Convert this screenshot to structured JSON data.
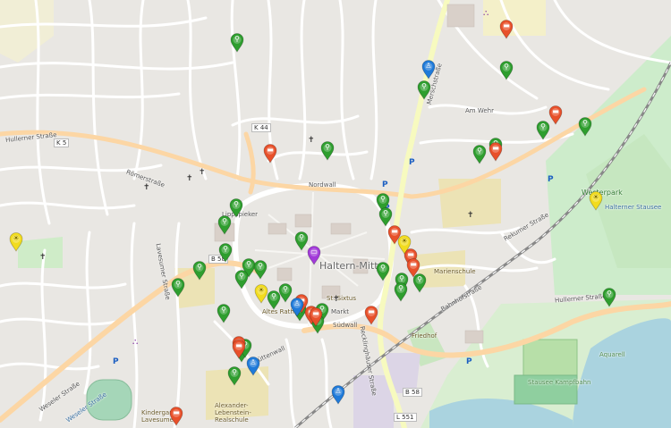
{
  "map": {
    "town_label": "Haltern-Mitte",
    "road_labels": [
      {
        "id": "k5",
        "text": "K 5"
      },
      {
        "id": "k44",
        "text": "K 44"
      },
      {
        "id": "b58-west",
        "text": "B 58"
      },
      {
        "id": "b58-east",
        "text": "B 58"
      },
      {
        "id": "l551",
        "text": "L 551"
      }
    ],
    "street_labels": [
      {
        "id": "st1",
        "text": "Hullerner Straße"
      },
      {
        "id": "st2",
        "text": "Römerstraße"
      },
      {
        "id": "st3",
        "text": "Lippspieker"
      },
      {
        "id": "st4",
        "text": "Nordwall"
      },
      {
        "id": "st5",
        "text": "Merschstraße"
      },
      {
        "id": "st6",
        "text": "Bahnhofstraße"
      },
      {
        "id": "st7",
        "text": "Hullerner Straße"
      },
      {
        "id": "st8",
        "text": "Weseler Straße"
      },
      {
        "id": "st9",
        "text": "Schüttenwall"
      },
      {
        "id": "st10",
        "text": "Recklinghäuser Straße"
      },
      {
        "id": "st11",
        "text": "Markt"
      },
      {
        "id": "st12",
        "text": "Südwall"
      },
      {
        "id": "st13",
        "text": "Rekumer Straße"
      },
      {
        "id": "st14",
        "text": "Am Wehr"
      },
      {
        "id": "st15",
        "text": "Lavesumer Straße"
      }
    ],
    "place_labels": [
      {
        "id": "pl1",
        "text": "Weseler Straße",
        "class": "water"
      },
      {
        "id": "pl2",
        "text": "Westerpark",
        "class": "park"
      },
      {
        "id": "pl3",
        "text": "Halterner Stausee",
        "class": "water"
      },
      {
        "id": "pl4",
        "text": "Stausee Kampfbahn",
        "class": "sport"
      },
      {
        "id": "pl5",
        "text": "Aquarell",
        "class": "sport"
      },
      {
        "id": "pl6",
        "text": "Alexander-Lebenstein-Realschule",
        "class": "school"
      },
      {
        "id": "pl7",
        "text": "Kindergarten Lavesumer",
        "class": "school"
      },
      {
        "id": "pl8",
        "text": "St. Sixtus",
        "class": "school"
      },
      {
        "id": "pl9",
        "text": "Altes Rathaus",
        "class": "school"
      },
      {
        "id": "pl10",
        "text": "Marienschule",
        "class": "school"
      },
      {
        "id": "pl11",
        "text": "Friedhof",
        "class": "school"
      }
    ],
    "markers": [
      {
        "id": "m1",
        "kind": "bike",
        "color": "#2e9e2e",
        "icon": "bicycle-icon"
      },
      {
        "id": "m2",
        "kind": "bike",
        "color": "#2e9e2e",
        "icon": "bicycle-icon"
      },
      {
        "id": "m3",
        "kind": "bike",
        "color": "#2e9e2e",
        "icon": "bicycle-icon"
      },
      {
        "id": "m4",
        "kind": "bike",
        "color": "#2e9e2e",
        "icon": "bicycle-icon"
      },
      {
        "id": "m5",
        "kind": "bike",
        "color": "#2e9e2e",
        "icon": "bicycle-icon"
      },
      {
        "id": "m6",
        "kind": "bike",
        "color": "#2e9e2e",
        "icon": "bicycle-icon"
      },
      {
        "id": "m7",
        "kind": "bike",
        "color": "#2e9e2e",
        "icon": "bicycle-icon"
      },
      {
        "id": "m8",
        "kind": "bike",
        "color": "#2e9e2e",
        "icon": "bicycle-icon"
      },
      {
        "id": "m9",
        "kind": "bike",
        "color": "#2e9e2e",
        "icon": "bicycle-icon"
      },
      {
        "id": "m10",
        "kind": "bike",
        "color": "#2e9e2e",
        "icon": "bicycle-icon"
      },
      {
        "id": "m11",
        "kind": "bike",
        "color": "#2e9e2e",
        "icon": "bicycle-icon"
      },
      {
        "id": "m12",
        "kind": "bike",
        "color": "#2e9e2e",
        "icon": "bicycle-icon"
      },
      {
        "id": "m13",
        "kind": "bike",
        "color": "#2e9e2e",
        "icon": "bicycle-icon"
      },
      {
        "id": "m14",
        "kind": "bike",
        "color": "#2e9e2e",
        "icon": "bicycle-icon"
      },
      {
        "id": "m15",
        "kind": "bike",
        "color": "#2e9e2e",
        "icon": "bicycle-icon"
      },
      {
        "id": "m16",
        "kind": "bike",
        "color": "#2e9e2e",
        "icon": "bicycle-icon"
      },
      {
        "id": "m17",
        "kind": "bike",
        "color": "#2e9e2e",
        "icon": "bicycle-icon"
      },
      {
        "id": "m18",
        "kind": "bike",
        "color": "#2e9e2e",
        "icon": "bicycle-icon"
      },
      {
        "id": "m19",
        "kind": "bike",
        "color": "#2e9e2e",
        "icon": "bicycle-icon"
      },
      {
        "id": "m20",
        "kind": "bike",
        "color": "#2e9e2e",
        "icon": "bicycle-icon"
      },
      {
        "id": "m21",
        "kind": "bike",
        "color": "#2e9e2e",
        "icon": "bicycle-icon"
      },
      {
        "id": "m22",
        "kind": "bike",
        "color": "#2e9e2e",
        "icon": "bicycle-icon"
      },
      {
        "id": "m23",
        "kind": "bike",
        "color": "#2e9e2e",
        "icon": "bicycle-icon"
      },
      {
        "id": "m24",
        "kind": "bike",
        "color": "#2e9e2e",
        "icon": "bicycle-icon"
      },
      {
        "id": "m25",
        "kind": "bike",
        "color": "#2e9e2e",
        "icon": "bicycle-icon"
      },
      {
        "id": "m26",
        "kind": "bike",
        "color": "#2e9e2e",
        "icon": "bicycle-icon"
      },
      {
        "id": "m27",
        "kind": "bike",
        "color": "#2e9e2e",
        "icon": "bicycle-icon"
      },
      {
        "id": "m28",
        "kind": "bike",
        "color": "#2e9e2e",
        "icon": "bicycle-icon"
      },
      {
        "id": "m29",
        "kind": "bike",
        "color": "#2e9e2e",
        "icon": "bicycle-icon"
      },
      {
        "id": "m30",
        "kind": "bike",
        "color": "#2e9e2e",
        "icon": "bicycle-icon"
      },
      {
        "id": "m31",
        "kind": "bike",
        "color": "#2e9e2e",
        "icon": "bicycle-icon"
      },
      {
        "id": "m32",
        "kind": "bike",
        "color": "#2e9e2e",
        "icon": "bicycle-icon"
      },
      {
        "id": "m33",
        "kind": "bike",
        "color": "#2e9e2e",
        "icon": "bicycle-icon"
      },
      {
        "id": "m34",
        "kind": "car",
        "color": "#e8502a",
        "icon": "car-icon"
      },
      {
        "id": "m35",
        "kind": "car",
        "color": "#e8502a",
        "icon": "car-icon"
      },
      {
        "id": "m36",
        "kind": "car",
        "color": "#e8502a",
        "icon": "car-icon"
      },
      {
        "id": "m37",
        "kind": "car",
        "color": "#e8502a",
        "icon": "car-icon"
      },
      {
        "id": "m38",
        "kind": "car",
        "color": "#e8502a",
        "icon": "car-icon"
      },
      {
        "id": "m39",
        "kind": "car",
        "color": "#e8502a",
        "icon": "car-icon"
      },
      {
        "id": "m40",
        "kind": "car",
        "color": "#e8502a",
        "icon": "car-icon"
      },
      {
        "id": "m41",
        "kind": "car",
        "color": "#e8502a",
        "icon": "car-icon"
      },
      {
        "id": "m42",
        "kind": "car",
        "color": "#e8502a",
        "icon": "car-icon"
      },
      {
        "id": "m43",
        "kind": "car",
        "color": "#e8502a",
        "icon": "car-icon"
      },
      {
        "id": "m44",
        "kind": "car",
        "color": "#e8502a",
        "icon": "car-icon"
      },
      {
        "id": "m45",
        "kind": "car",
        "color": "#e8502a",
        "icon": "car-icon"
      },
      {
        "id": "m46",
        "kind": "car",
        "color": "#e8502a",
        "icon": "car-icon"
      },
      {
        "id": "m47",
        "kind": "car",
        "color": "#e8502a",
        "icon": "car-icon"
      },
      {
        "id": "m48",
        "kind": "pedestrian",
        "color": "#1f7ad9",
        "icon": "pedestrian-icon"
      },
      {
        "id": "m49",
        "kind": "pedestrian",
        "color": "#1f7ad9",
        "icon": "pedestrian-icon"
      },
      {
        "id": "m50",
        "kind": "pedestrian",
        "color": "#1f7ad9",
        "icon": "pedestrian-icon"
      },
      {
        "id": "m51",
        "kind": "pedestrian",
        "color": "#1f7ad9",
        "icon": "pedestrian-icon"
      },
      {
        "id": "m52",
        "kind": "sun",
        "color": "#f2dc1e",
        "icon": "sun-icon"
      },
      {
        "id": "m53",
        "kind": "sun",
        "color": "#f2dc1e",
        "icon": "sun-icon"
      },
      {
        "id": "m54",
        "kind": "sun",
        "color": "#f2dc1e",
        "icon": "sun-icon"
      },
      {
        "id": "m55",
        "kind": "sun",
        "color": "#f2dc1e",
        "icon": "sun-icon"
      },
      {
        "id": "m56",
        "kind": "bus",
        "color": "#a23ad9",
        "icon": "bus-icon"
      }
    ],
    "poi_symbols": [
      {
        "id": "p1",
        "glyph": "✝",
        "icon": "church-icon"
      },
      {
        "id": "p2",
        "glyph": "✝",
        "icon": "church-icon"
      },
      {
        "id": "p3",
        "glyph": "✝",
        "icon": "church-icon"
      },
      {
        "id": "p4",
        "glyph": "✝",
        "icon": "church-icon"
      },
      {
        "id": "p5",
        "glyph": "✝",
        "icon": "church-icon"
      },
      {
        "id": "p6",
        "glyph": "✝",
        "icon": "church-icon"
      },
      {
        "id": "p7",
        "glyph": "✝",
        "icon": "church-icon"
      },
      {
        "id": "p8",
        "glyph": "P",
        "icon": "parking-icon"
      },
      {
        "id": "p9",
        "glyph": "P",
        "icon": "parking-icon"
      },
      {
        "id": "p10",
        "glyph": "P",
        "icon": "parking-icon"
      },
      {
        "id": "p11",
        "glyph": "P",
        "icon": "parking-icon"
      },
      {
        "id": "p12",
        "glyph": "P",
        "icon": "parking-icon"
      },
      {
        "id": "p13",
        "glyph": "P",
        "icon": "parking-icon"
      },
      {
        "id": "p14",
        "glyph": "⛬",
        "icon": "shop-icon"
      },
      {
        "id": "p15",
        "glyph": "⛬",
        "icon": "shop-icon"
      }
    ]
  }
}
